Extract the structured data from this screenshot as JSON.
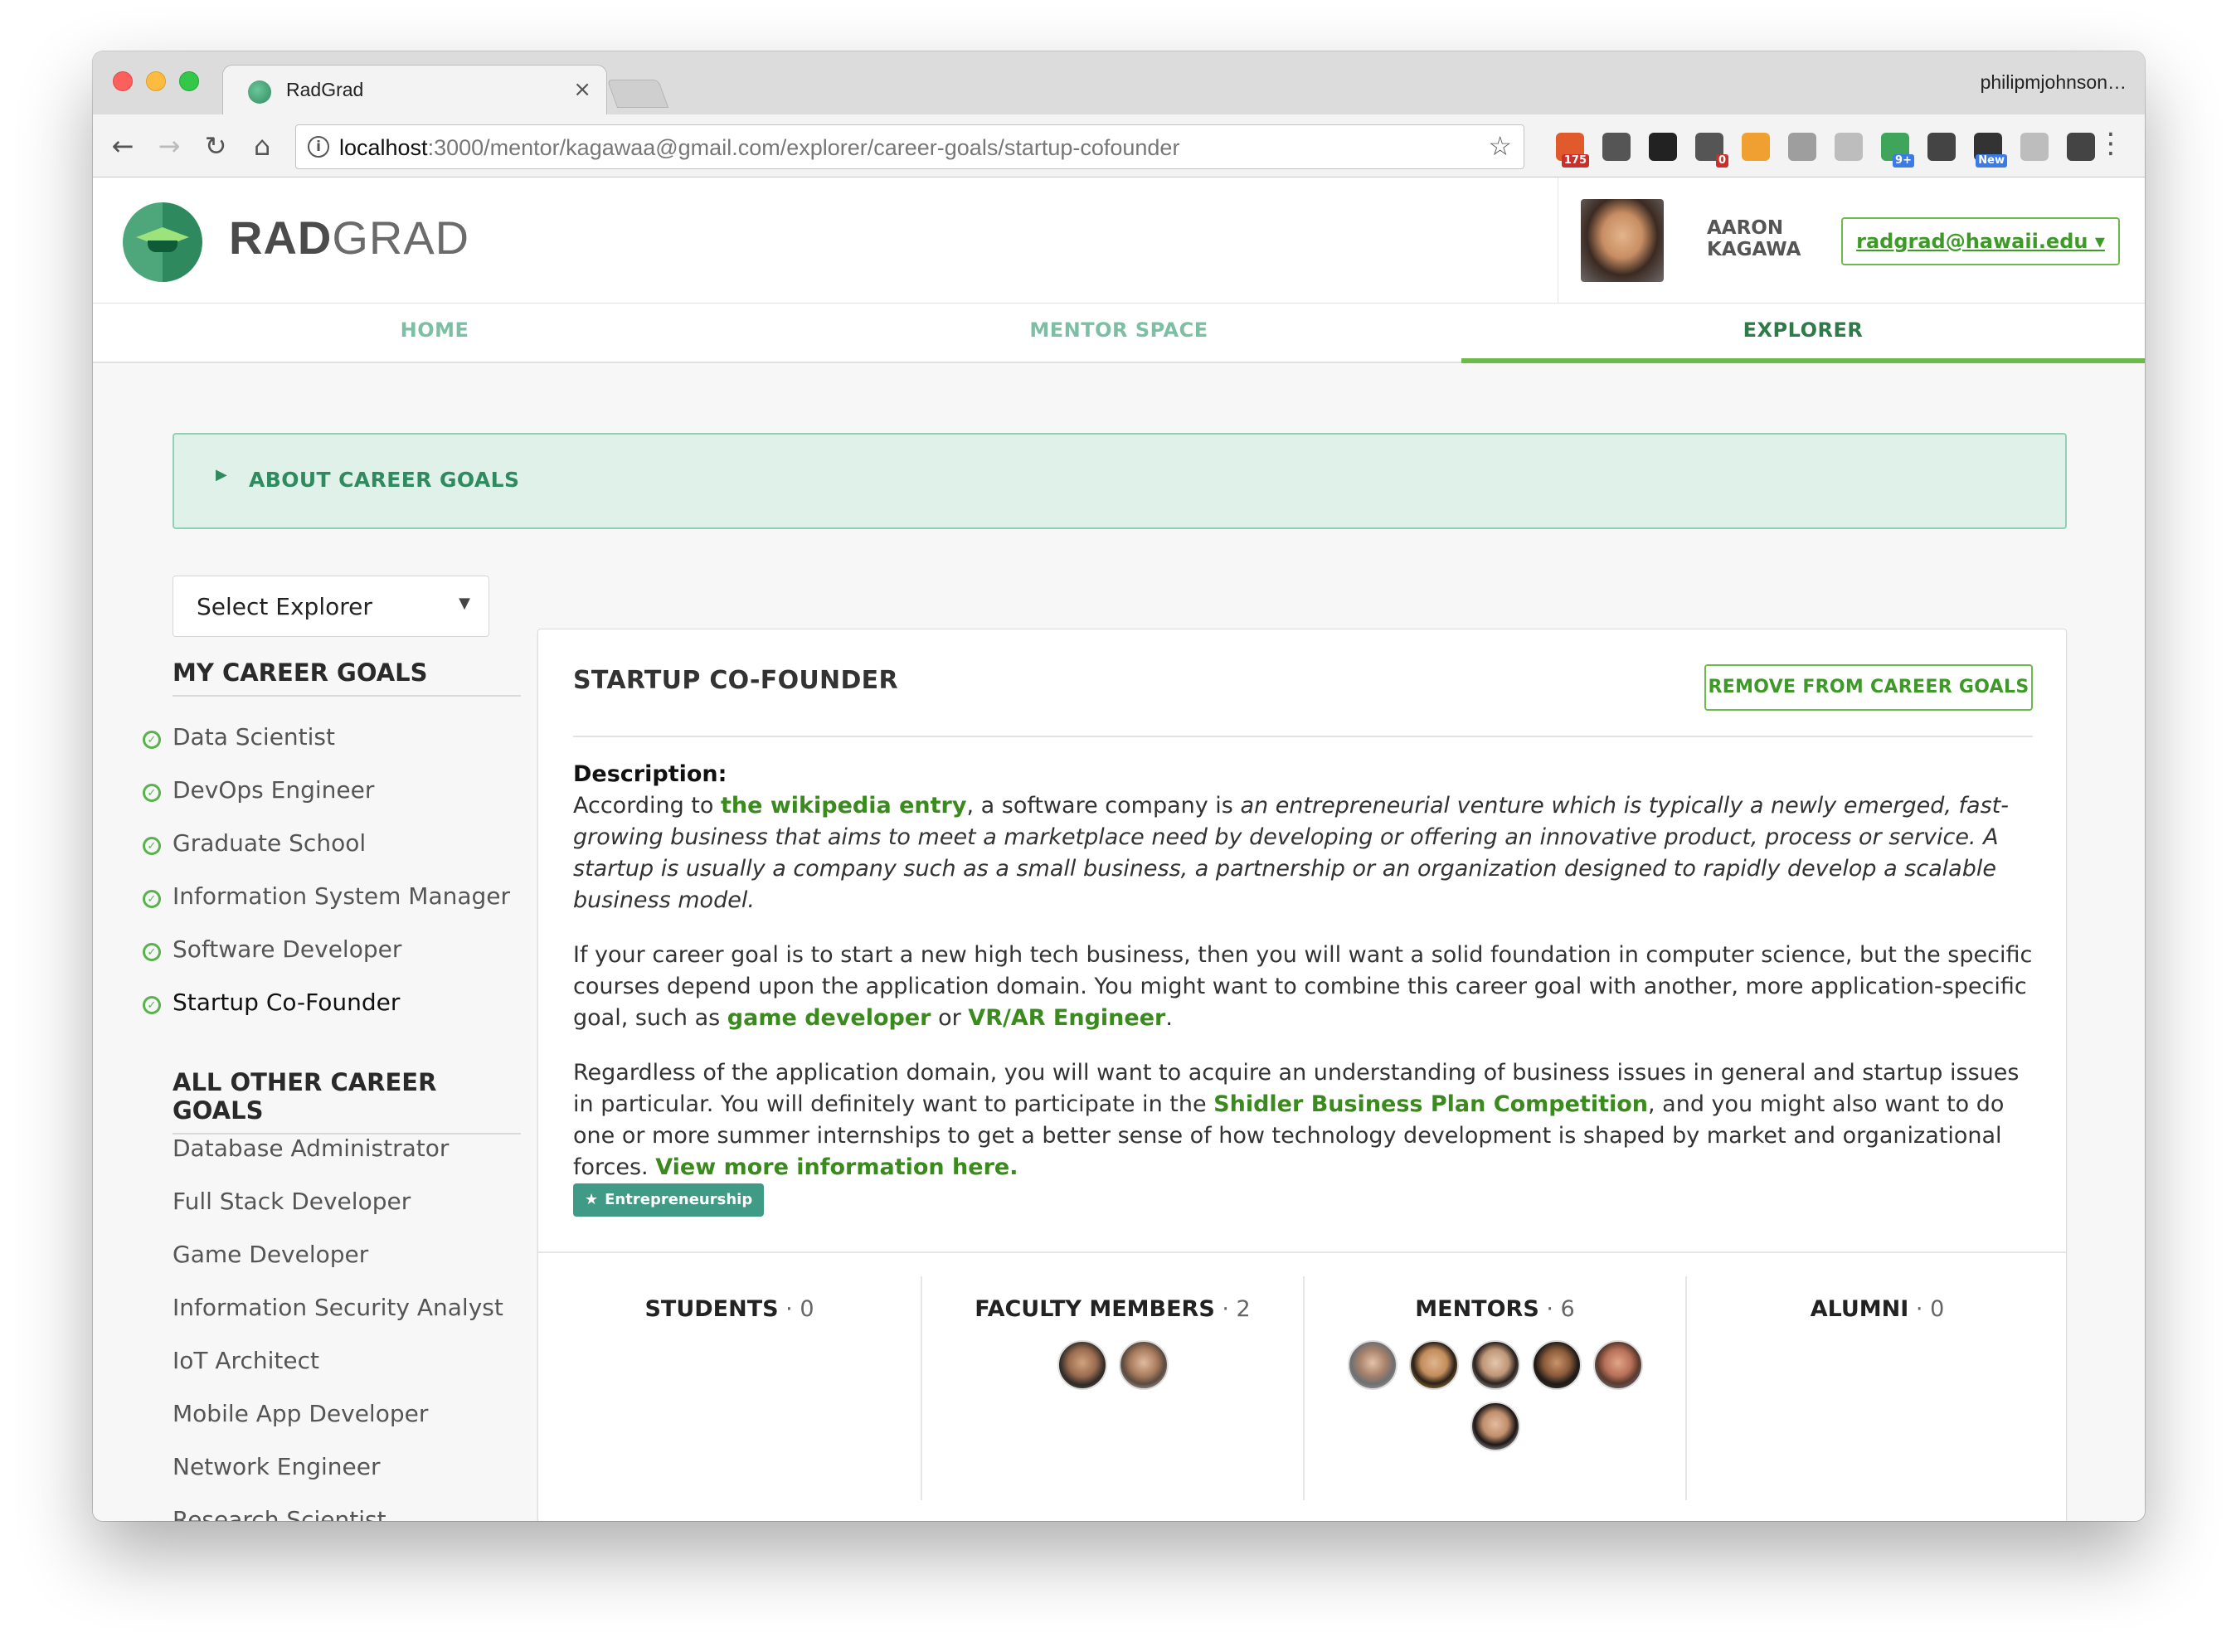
{
  "browser": {
    "tab_title": "RadGrad",
    "tab_close": "×",
    "profile_name": "philipmjohnson…",
    "url_host": "localhost",
    "url_path": ":3000/mentor/kagawaa@gmail.com/explorer/career-goals/startup-cofounder",
    "extensions": [
      {
        "name": "rss-extension-icon",
        "badge": "175",
        "color": "#e05a2b"
      },
      {
        "name": "onepassword-icon",
        "badge": "",
        "color": "#555555"
      },
      {
        "name": "jetbrains-icon",
        "badge": "",
        "color": "#222222"
      },
      {
        "name": "lastpass-icon",
        "badge": "0",
        "color": "#555555"
      },
      {
        "name": "analytics-icon",
        "badge": "",
        "color": "#f0a030"
      },
      {
        "name": "screenshot-icon",
        "badge": "",
        "color": "#9e9e9e"
      },
      {
        "name": "drive-icon",
        "badge": "",
        "color": "#bdbdbd"
      },
      {
        "name": "hangouts-icon",
        "badge": "9+",
        "color": "#3ea55b"
      },
      {
        "name": "eyedropper-icon",
        "badge": "",
        "color": "#444444"
      },
      {
        "name": "new-extension-icon",
        "badge": "New",
        "color": "#333333"
      },
      {
        "name": "incognito-icon",
        "badge": "",
        "color": "#bdbdbd"
      },
      {
        "name": "sync-icon",
        "badge": "",
        "color": "#444444"
      }
    ]
  },
  "header": {
    "brand_bold": "RAD",
    "brand_light": "GRAD",
    "user_name": "AARON KAGAWA",
    "email_button": "radgrad@hawaii.edu ▾"
  },
  "nav": {
    "tabs": [
      "HOME",
      "MENTOR SPACE",
      "EXPLORER"
    ],
    "active": "EXPLORER"
  },
  "about": {
    "label": "ABOUT CAREER GOALS"
  },
  "sidebar": {
    "select_label": "Select Explorer",
    "my_goals_heading": "MY CAREER GOALS",
    "my_goals": [
      "Data Scientist",
      "DevOps Engineer",
      "Graduate School",
      "Information System Manager",
      "Software Developer",
      "Startup Co-Founder"
    ],
    "current_goal": "Startup Co-Founder",
    "other_goals_heading": "ALL OTHER CAREER GOALS",
    "other_goals": [
      "Database Administrator",
      "Full Stack Developer",
      "Game Developer",
      "Information Security Analyst",
      "IoT Architect",
      "Mobile App Developer",
      "Network Engineer",
      "Research Scientist"
    ]
  },
  "card": {
    "title": "STARTUP CO-FOUNDER",
    "remove_button": "REMOVE FROM CAREER GOALS",
    "description_label": "Description:",
    "p1_a": "According to ",
    "p1_link": "the wikipedia entry",
    "p1_b": ", a software company is ",
    "p1_quote": "an entrepreneurial venture which is typically a newly emerged, fast-growing business that aims to meet a marketplace need by developing or offering an innovative product, process or service. A startup is usually a company such as a small business, a partnership or an organization designed to rapidly develop a scalable business model.",
    "p2_a": "If your career goal is to start a new high tech business, then you will want a solid foundation in computer science, but the specific courses depend upon the application domain. You might want to combine this career goal with another, more application-specific goal, such as ",
    "p2_link1": "game developer",
    "p2_b": " or ",
    "p2_link2": "VR/AR Engineer",
    "p2_c": ".",
    "p3_a": "Regardless of the application domain, you will want to acquire an understanding of business issues in general and startup issues in particular. You will definitely want to participate in the ",
    "p3_link1": "Shidler Business Plan Competition",
    "p3_b": ", and you might also want to do one or more summer internships to get a better sense of how technology development is shaped by market and organizational forces. ",
    "p3_link2": "View more information here.",
    "tag": "Entrepreneurship"
  },
  "stats": [
    {
      "label": "STUDENTS",
      "count": "0"
    },
    {
      "label": "FACULTY MEMBERS",
      "count": "2"
    },
    {
      "label": "MENTORS",
      "count": "6"
    },
    {
      "label": "ALUMNI",
      "count": "0"
    }
  ]
}
